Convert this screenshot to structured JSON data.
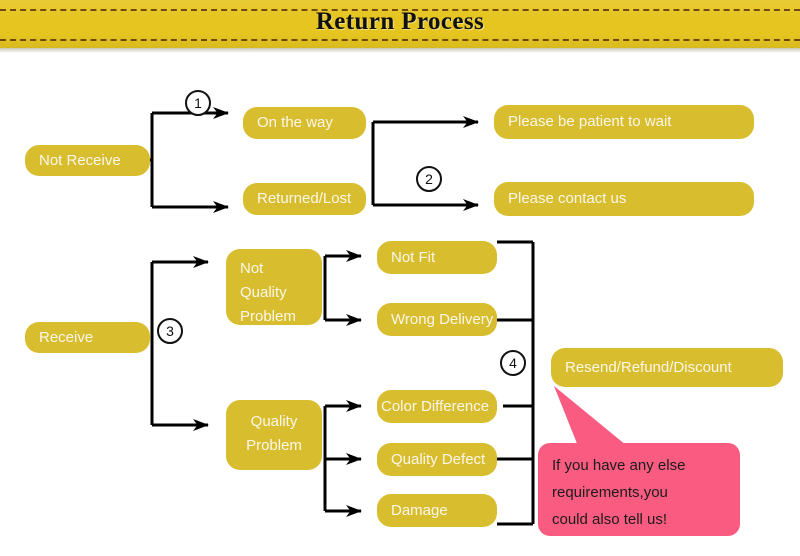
{
  "header": {
    "title": "Return Process",
    "banner_color": "#e6c520",
    "dash_color": "#6e4a12"
  },
  "theme": {
    "node_fill": "#d8bd2e",
    "node_text": "#fbf7ea",
    "line_color": "#000000",
    "callout_fill": "#fa5c81",
    "callout_text": "#1b1b1b"
  },
  "flow": {
    "branch_not_receive": {
      "root": "Not Receive",
      "step_marker": "1",
      "states": [
        {
          "label": "On the way"
        },
        {
          "label": "Returned/Lost"
        }
      ],
      "step_marker_2": "2",
      "actions": [
        {
          "label": "Please be patient to wait"
        },
        {
          "label": "Please contact us"
        }
      ]
    },
    "branch_receive": {
      "root": "Receive",
      "step_marker": "3",
      "categories": [
        {
          "label": "Not Quality Problem",
          "lines": [
            "Not",
            "Quality",
            "Problem"
          ]
        },
        {
          "label": "Quality Problem",
          "lines": [
            "Quality",
            "Problem"
          ]
        }
      ],
      "step_marker_4": "4",
      "reasons_not_quality": [
        {
          "label": "Not Fit"
        },
        {
          "label": "Wrong Delivery"
        }
      ],
      "reasons_quality": [
        {
          "label": "Color Difference"
        },
        {
          "label": "Quality Defect"
        },
        {
          "label": "Damage"
        }
      ],
      "resolution": "Resend/Refund/Discount"
    }
  },
  "callout": {
    "lines": [
      "If you have any else",
      "requirements,you",
      "could also tell us!"
    ]
  }
}
